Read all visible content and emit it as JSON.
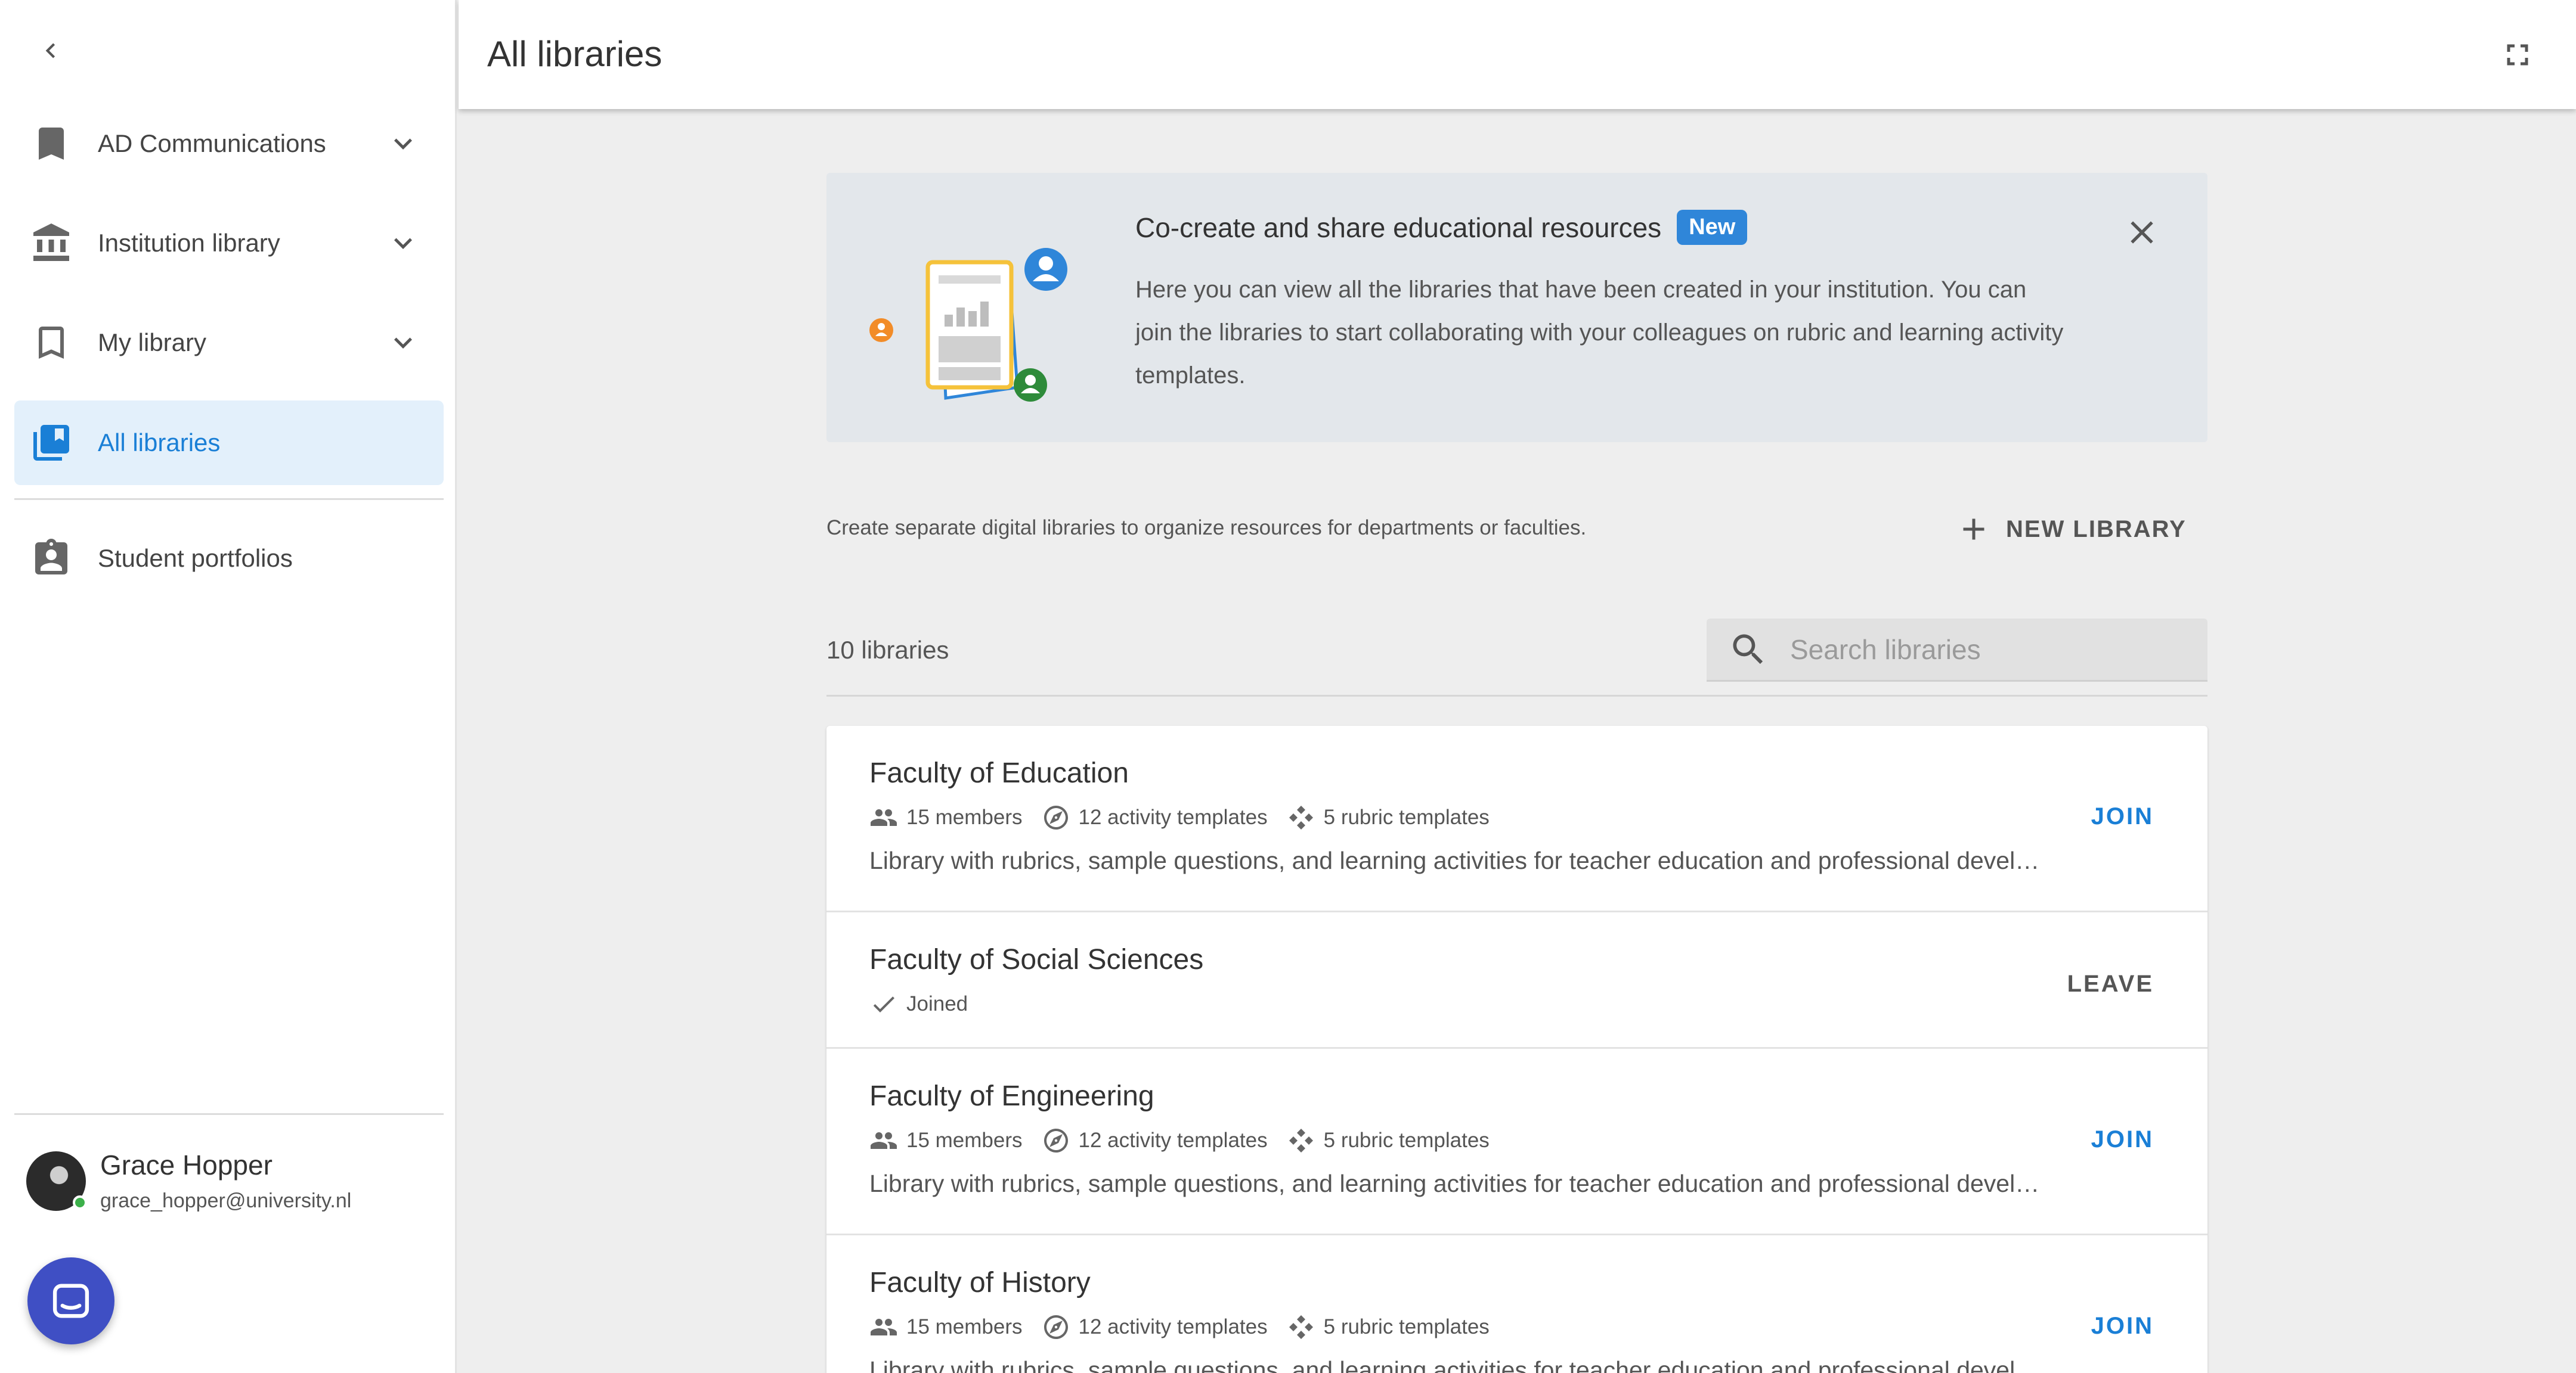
{
  "header": {
    "title": "All libraries"
  },
  "sidebar": {
    "items": [
      {
        "label": "AD Communications",
        "icon": "bookmark-filled-icon"
      },
      {
        "label": "Institution library",
        "icon": "institution-icon"
      },
      {
        "label": "My library",
        "icon": "bookmark-outline-icon"
      },
      {
        "label": "All libraries",
        "icon": "libraries-icon",
        "active": true
      },
      {
        "label": "Student portfolios",
        "icon": "portfolio-icon"
      }
    ],
    "user": {
      "name": "Grace Hopper",
      "email": "grace_hopper@university.nl",
      "status": "online"
    }
  },
  "banner": {
    "title": "Co-create and share educational resources",
    "badge": "New",
    "body": "Here you can view all the libraries that have been created in your institution. You can join the libraries to start collaborating with your colleagues on rubric and learning activity templates."
  },
  "main": {
    "description": "Create separate digital libraries to organize resources for departments or faculties.",
    "new_library_label": "NEW LIBRARY",
    "count_label": "10 libraries",
    "search": {
      "placeholder": "Search libraries",
      "value": ""
    },
    "libraries": [
      {
        "name": "Faculty of Education",
        "members": "15 members",
        "activity_templates": "12 activity templates",
        "rubric_templates": "5 rubric templates",
        "description": "Library with rubrics, sample questions, and learning activities for teacher education and professional development.",
        "action": "JOIN"
      },
      {
        "name": "Faculty of Social Sciences",
        "status": "Joined",
        "action": "LEAVE"
      },
      {
        "name": "Faculty of Engineering",
        "members": "15 members",
        "activity_templates": "12 activity templates",
        "rubric_templates": "5 rubric templates",
        "description": "Library with rubrics, sample questions, and learning activities for teacher education and professional development.",
        "action": "JOIN"
      },
      {
        "name": "Faculty of History",
        "members": "15 members",
        "activity_templates": "12 activity templates",
        "rubric_templates": "5 rubric templates",
        "description": "Library with rubrics, sample questions, and learning activities for teacher education and professional development.",
        "action": "JOIN"
      }
    ]
  },
  "colors": {
    "accent": "#1a7fd6",
    "active_bg": "#e3f0fb",
    "badge": "#2f86d9",
    "chat_fab": "#3f4fc4"
  }
}
